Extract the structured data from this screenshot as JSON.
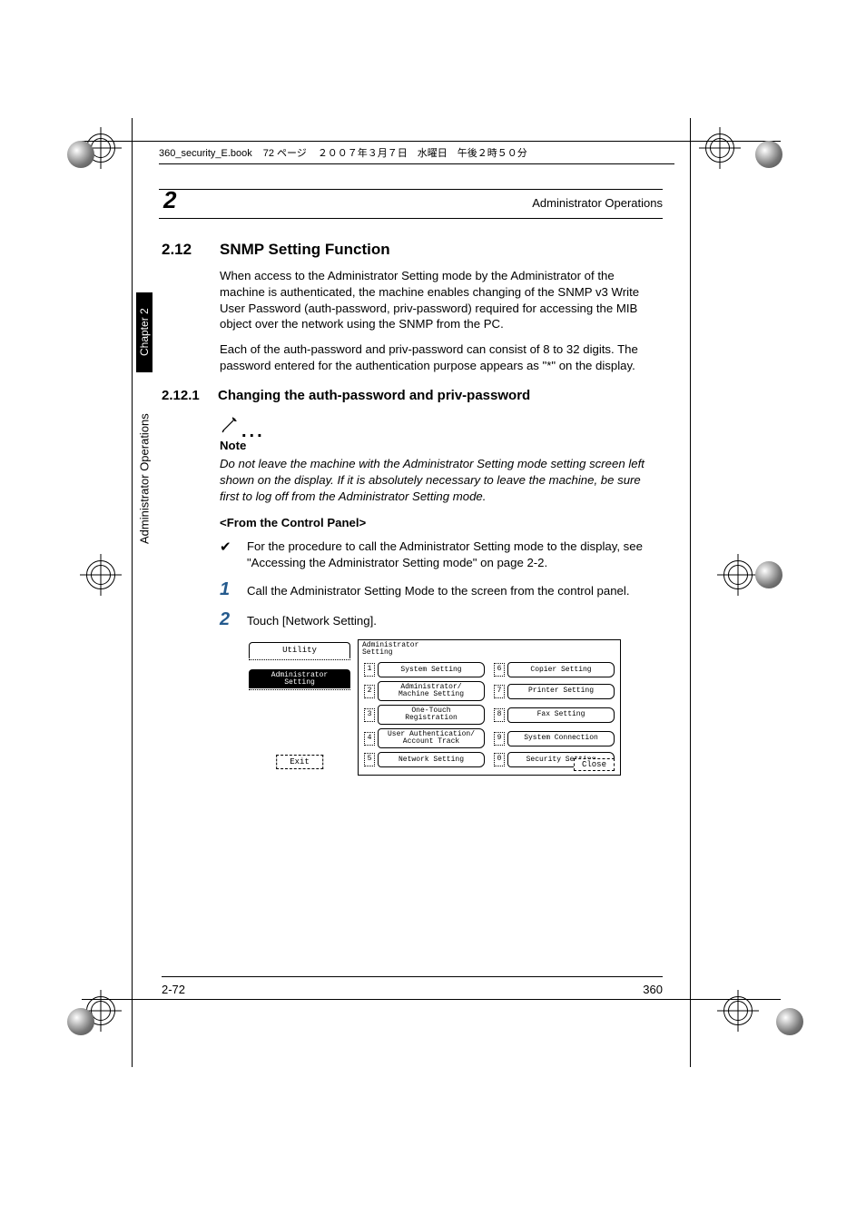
{
  "header": {
    "filename": "360_security_E.book",
    "page_info": "72 ページ",
    "date": "２００７年３月７日　水曜日　午後２時５０分"
  },
  "running_head": "Administrator Operations",
  "chapter_number": "2",
  "sidebar": {
    "chapter_tab": "Chapter 2",
    "section_tab": "Administrator Operations"
  },
  "sec": {
    "num": "2.12",
    "title": "SNMP Setting Function",
    "para1": "When access to the Administrator Setting mode by the Administrator of the machine is authenticated, the machine enables changing of the SNMP v3 Write User Password (auth-password, priv-password) required for accessing the MIB object over the network using the SNMP from the PC.",
    "para2": "Each of the auth-password and priv-password can consist of 8 to 32 digits. The password entered for the authentication purpose appears as \"*\" on the display."
  },
  "sub": {
    "num": "2.12.1",
    "title": "Changing the auth-password and priv-password"
  },
  "note": {
    "label": "Note",
    "body": "Do not leave the machine with the Administrator Setting mode setting screen left shown on the display. If it is absolutely necessary to leave the machine, be sure first to log off from the Administrator Setting mode."
  },
  "panel_head": "<From the Control Panel>",
  "check": "For the procedure to call the Administrator Setting mode to the display, see \"Accessing the Administrator Setting mode\" on page 2-2.",
  "steps": {
    "s1_num": "1",
    "s1": "Call the Administrator Setting Mode to the screen from the control panel.",
    "s2_num": "2",
    "s2": "Touch [Network Setting]."
  },
  "screen": {
    "left_tab1": "Utility",
    "left_tab2": "Administrator\nSetting",
    "exit": "Exit",
    "title_l1": "Administrator",
    "title_l2": "Setting",
    "close": "Close",
    "items": [
      {
        "n": "1",
        "label": "System Setting"
      },
      {
        "n": "2",
        "label": "Administrator/\nMachine Setting"
      },
      {
        "n": "3",
        "label": "One-Touch\nRegistration"
      },
      {
        "n": "4",
        "label": "User Authentication/\nAccount Track"
      },
      {
        "n": "5",
        "label": "Network Setting"
      },
      {
        "n": "6",
        "label": "Copier Setting"
      },
      {
        "n": "7",
        "label": "Printer Setting"
      },
      {
        "n": "8",
        "label": "Fax Setting"
      },
      {
        "n": "9",
        "label": "System Connection"
      },
      {
        "n": "0",
        "label": "Security Setting"
      }
    ]
  },
  "footer": {
    "left": "2-72",
    "right": "360"
  }
}
